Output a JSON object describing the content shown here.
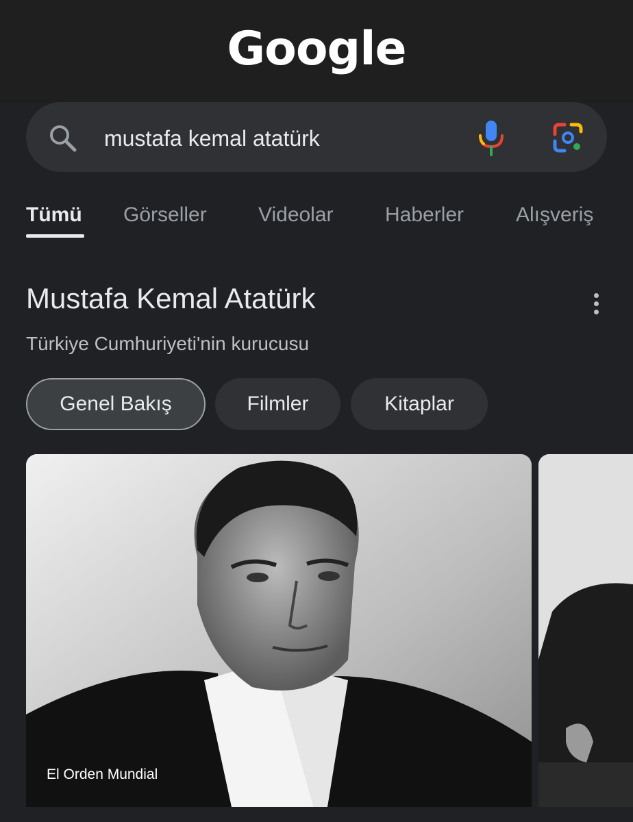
{
  "logo": {
    "text": "Google"
  },
  "search": {
    "query": "mustafa kemal atatürk"
  },
  "tabs": [
    {
      "label": "Tümü"
    },
    {
      "label": "Görseller"
    },
    {
      "label": "Videolar"
    },
    {
      "label": "Haberler"
    },
    {
      "label": "Alışveriş"
    }
  ],
  "knowledge_panel": {
    "title": "Mustafa Kemal Atatürk",
    "subtitle": "Türkiye Cumhuriyeti'nin kurucusu",
    "chips": [
      {
        "label": "Genel Bakış"
      },
      {
        "label": "Filmler"
      },
      {
        "label": "Kitaplar"
      }
    ],
    "images": [
      {
        "source": "El Orden Mundial"
      }
    ]
  },
  "colors": {
    "background": "#202124",
    "surface": "#303134",
    "text": "#e8eaed",
    "muted_text": "#9aa0a6"
  },
  "icons": [
    "search-icon",
    "microphone-icon",
    "google-lens-icon",
    "more-vert-icon"
  ]
}
